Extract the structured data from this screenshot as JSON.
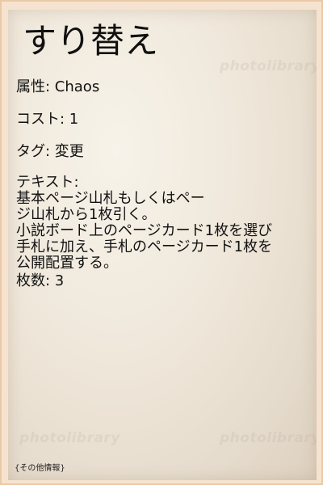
{
  "card": {
    "title": "すり替え",
    "attribute_label": "属性",
    "attribute_value": "Chaos",
    "cost_label": "コスト",
    "cost_value": "1",
    "tag_label": "タグ",
    "tag_value": "変更",
    "text_label": "テキスト",
    "text_lines": [
      "基本ページ山札もしくはペー",
      "ジ山札から1枚引く。",
      "小説ボード上のページカード1枚を選び",
      "手札に加え、手札のページカード1枚を",
      "公開配置する。"
    ],
    "count_label": "枚数",
    "count_value": "3",
    "footer": "{その他情報}"
  },
  "watermark": {
    "text": "photolibrary"
  }
}
